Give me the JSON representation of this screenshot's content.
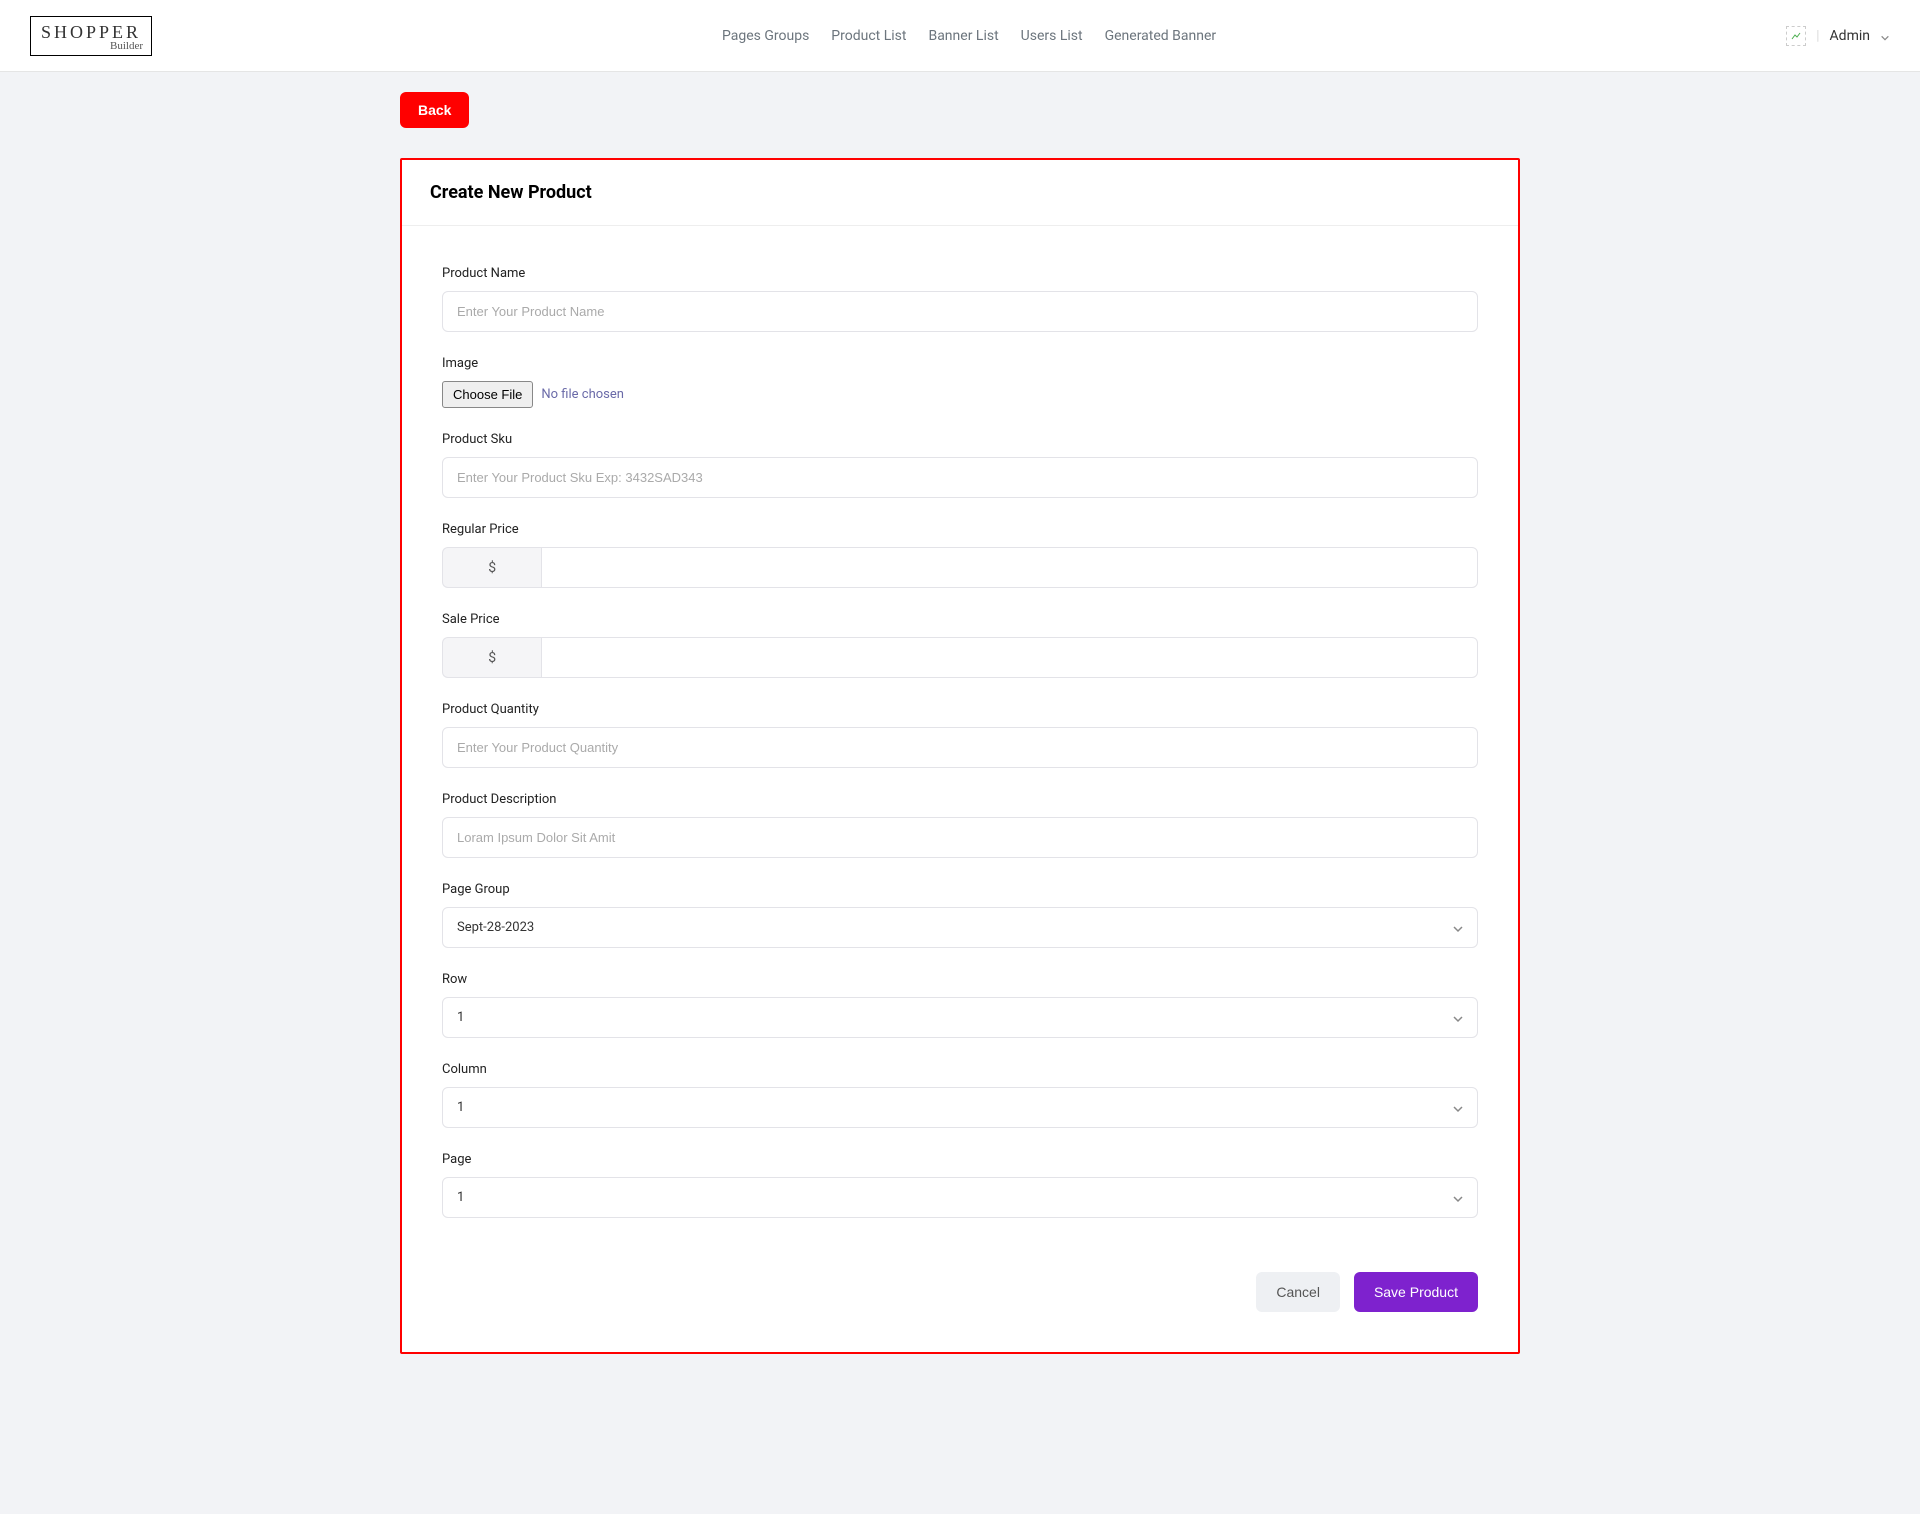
{
  "brand": {
    "name": "SHOPPER",
    "sub": "Builder"
  },
  "nav": {
    "pages_groups": "Pages Groups",
    "product_list": "Product List",
    "banner_list": "Banner List",
    "users_list": "Users List",
    "generated_banner": "Generated Banner"
  },
  "user": {
    "name": "Admin"
  },
  "back_label": "Back",
  "card_title": "Create New Product",
  "form": {
    "product_name": {
      "label": "Product Name",
      "placeholder": "Enter Your Product Name"
    },
    "image": {
      "label": "Image",
      "choose": "Choose File",
      "status": "No file chosen"
    },
    "sku": {
      "label": "Product Sku",
      "placeholder": "Enter Your Product Sku Exp: 3432SAD343"
    },
    "regular_price": {
      "label": "Regular Price",
      "prefix": "$"
    },
    "sale_price": {
      "label": "Sale Price",
      "prefix": "$"
    },
    "quantity": {
      "label": "Product Quantity",
      "placeholder": "Enter Your Product Quantity"
    },
    "description": {
      "label": "Product Description",
      "placeholder": "Loram Ipsum Dolor Sit Amit"
    },
    "page_group": {
      "label": "Page Group",
      "value": "Sept-28-2023"
    },
    "row": {
      "label": "Row",
      "value": "1"
    },
    "column": {
      "label": "Column",
      "value": "1"
    },
    "page": {
      "label": "Page",
      "value": "1"
    }
  },
  "footer": {
    "cancel": "Cancel",
    "save": "Save Product"
  }
}
